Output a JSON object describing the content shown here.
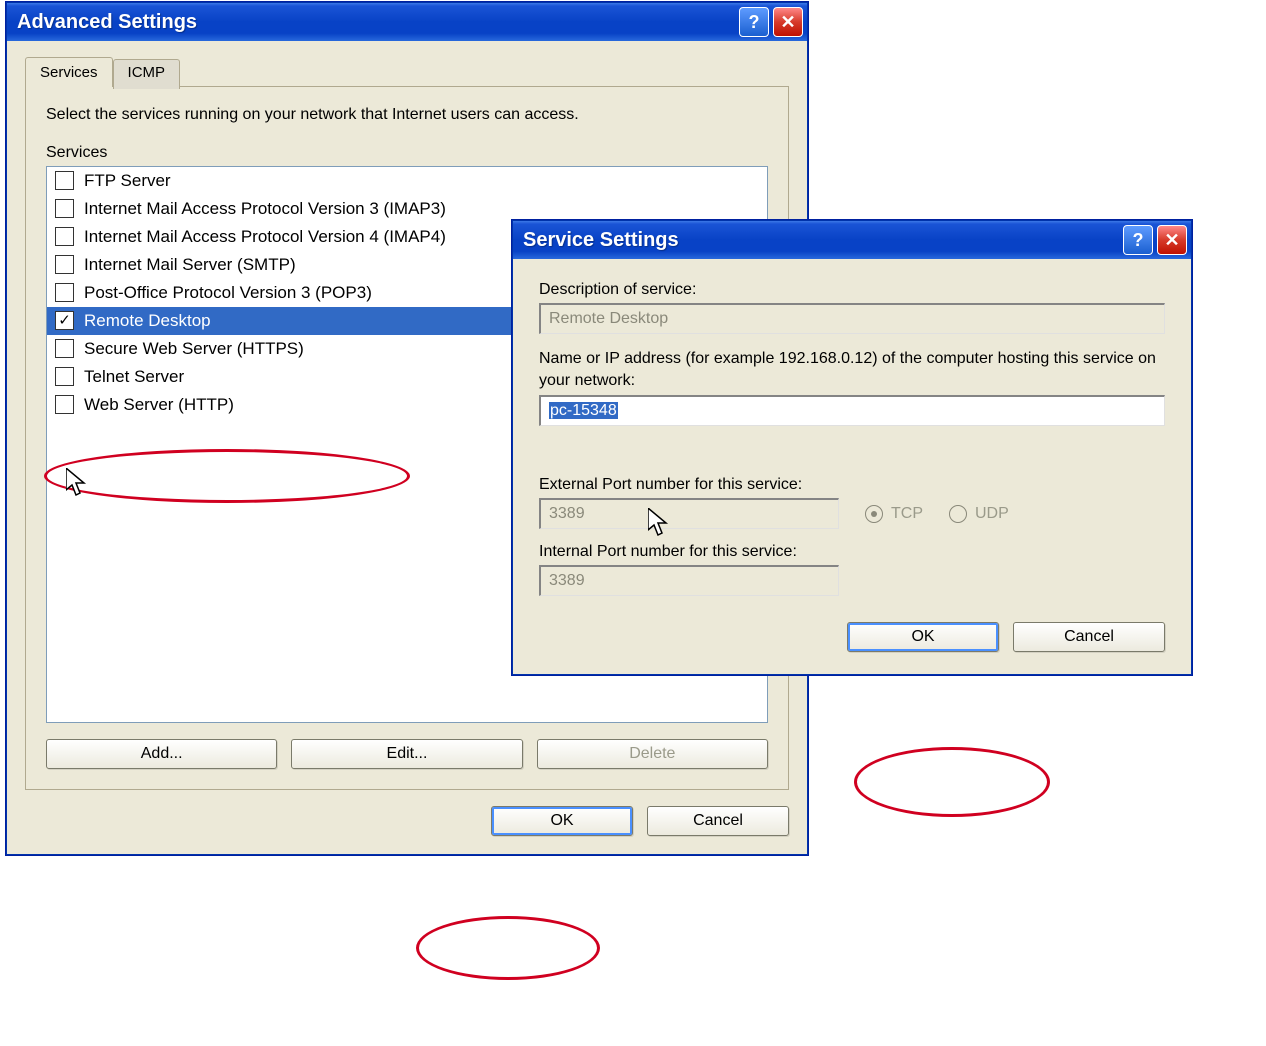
{
  "advanced": {
    "title": "Advanced Settings",
    "tabs": {
      "services": "Services",
      "icmp": "ICMP"
    },
    "instruction": "Select the services running on your network that Internet users can access.",
    "section_label": "Services",
    "items": [
      {
        "label": "FTP Server",
        "checked": false
      },
      {
        "label": "Internet Mail Access Protocol Version 3 (IMAP3)",
        "checked": false
      },
      {
        "label": "Internet Mail Access Protocol Version 4 (IMAP4)",
        "checked": false
      },
      {
        "label": "Internet Mail Server (SMTP)",
        "checked": false
      },
      {
        "label": "Post-Office Protocol Version 3 (POP3)",
        "checked": false
      },
      {
        "label": "Remote Desktop",
        "checked": true,
        "selected": true
      },
      {
        "label": "Secure Web Server (HTTPS)",
        "checked": false
      },
      {
        "label": "Telnet Server",
        "checked": false
      },
      {
        "label": "Web Server (HTTP)",
        "checked": false
      }
    ],
    "buttons": {
      "add": "Add...",
      "edit": "Edit...",
      "delete": "Delete"
    },
    "ok": "OK",
    "cancel": "Cancel"
  },
  "service": {
    "title": "Service Settings",
    "desc_label": "Description of service:",
    "desc_value": "Remote Desktop",
    "ip_label": "Name or IP address (for example 192.168.0.12) of the computer hosting this service on your network:",
    "ip_value": "pc-15348",
    "ext_label": "External Port number for this service:",
    "ext_value": "3389",
    "int_label": "Internal Port number for this service:",
    "int_value": "3389",
    "tcp": "TCP",
    "udp": "UDP",
    "ok": "OK",
    "cancel": "Cancel"
  }
}
